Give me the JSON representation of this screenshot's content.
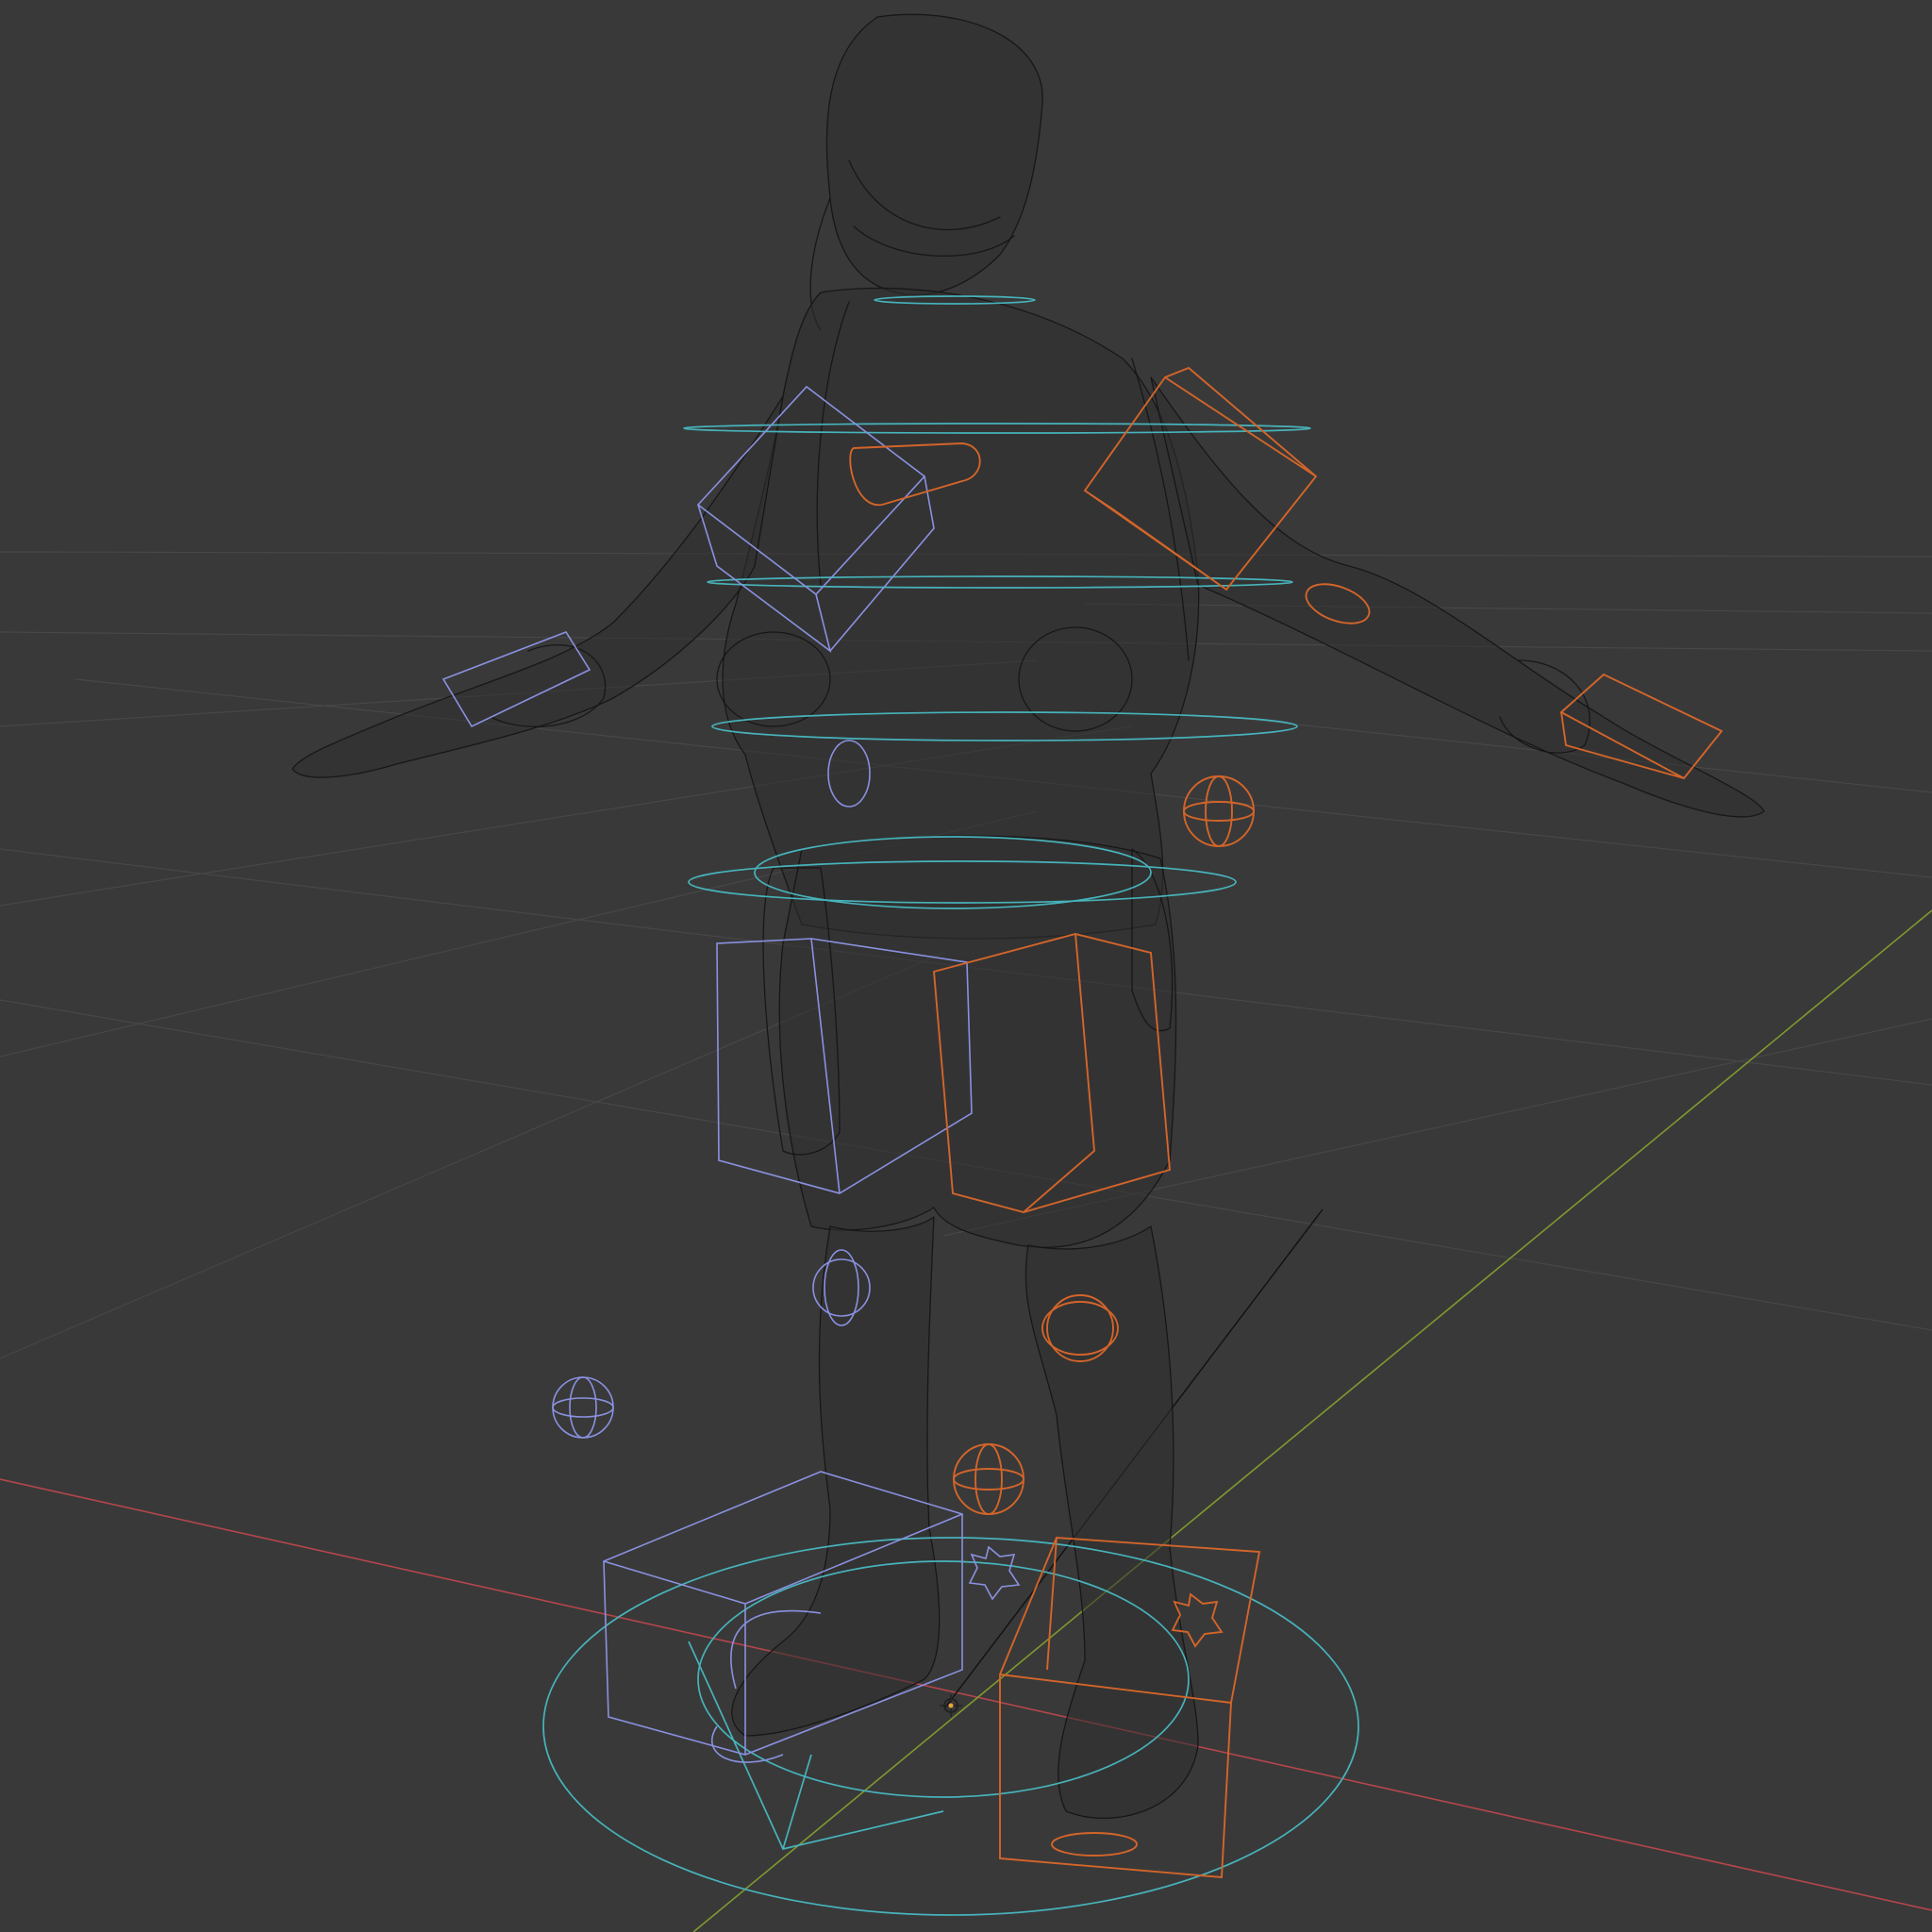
{
  "viewport": {
    "background_color": "#393939",
    "grid_color": "#474747",
    "x_axis_color": "#b5464c",
    "y_axis_color": "#7f9a2e",
    "mesh_color": "#141414"
  },
  "rig": {
    "left_controls_color": "#8a91e0",
    "right_controls_color": "#d3652a",
    "center_controls_color": "#47b3bb"
  },
  "icons": {
    "origin": "crosshair-origin-icon",
    "control_sphere": "sphere-control-icon",
    "control_cube": "cube-control-icon",
    "control_ring": "ring-control-icon"
  }
}
